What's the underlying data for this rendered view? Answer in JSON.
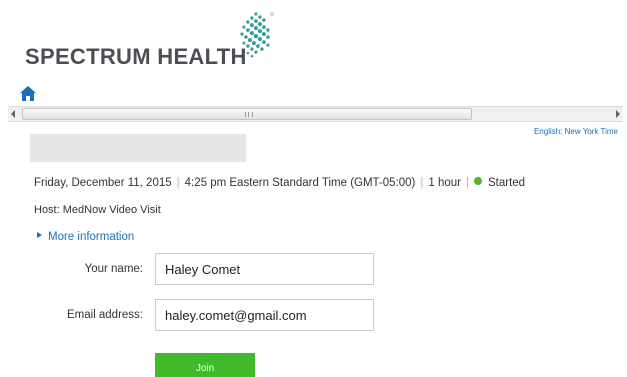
{
  "brand": {
    "logo_text": "SPECTRUM HEALTH",
    "logo_icon": "spectrum-grid-logo-icon",
    "accent_color": "#1a6fb8"
  },
  "nav": {
    "home_icon": "home-icon"
  },
  "header": {
    "language_link": "English: New York Time"
  },
  "meeting": {
    "title": "",
    "date": "Friday, December 11, 2015",
    "time": "4:25 pm Eastern Standard Time (GMT-05:00)",
    "duration": "1 hour",
    "status": "Started",
    "status_color": "#55b531",
    "host": "Host: MedNow Video Visit",
    "more_info_label": "More information"
  },
  "form": {
    "name_label": "Your name:",
    "name_value": "Haley Comet",
    "email_label": "Email address:",
    "email_value": "haley.comet@gmail.com",
    "join_label": "Join",
    "join_color": "#3fba2a"
  }
}
